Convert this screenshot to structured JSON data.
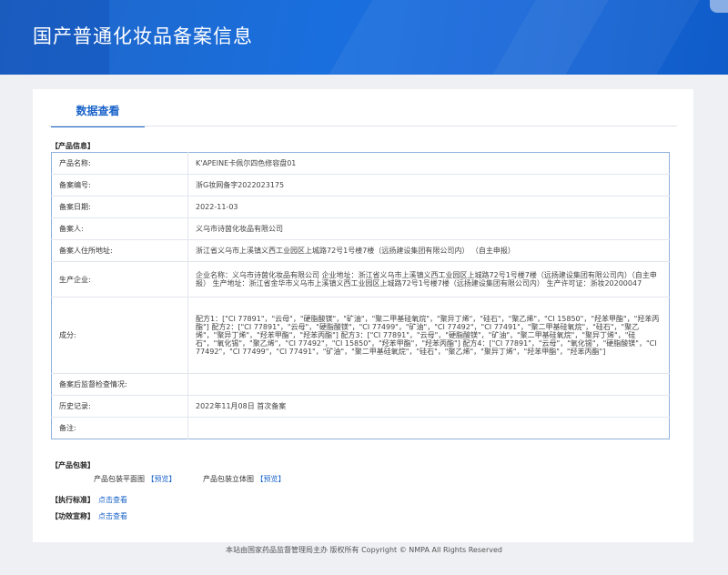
{
  "page_title": "国产普通化妆品备案信息",
  "tab_label": "数据查看",
  "product_info": {
    "section_title": "【产品信息】",
    "rows": [
      {
        "key": "产品名称:",
        "value": "K'APEINE卡佩尔四色修容盘01"
      },
      {
        "key": "备案编号:",
        "value": "浙G妆网备字2022023175"
      },
      {
        "key": "备案日期:",
        "value": "2022-11-03"
      },
      {
        "key": "备案人:",
        "value": "义乌市诗茵化妆品有限公司"
      },
      {
        "key": "备案人住所地址:",
        "value": "浙江省义乌市上溪镇义西工业园区上城路72号1号楼7楼（远扬建设集团有限公司内） （自主申报）"
      },
      {
        "key": "生产企业:",
        "value": "企业名称：义乌市诗茵化妆品有限公司 企业地址：浙江省义乌市上溪镇义西工业园区上城路72号1号楼7楼（远扬建设集团有限公司内）（自主申报） 生产地址：浙江省金华市义乌市上溪镇义西工业园区上城路72号1号楼7楼（远扬建设集团有限公司内） 生产许可证：浙妆20200047"
      },
      {
        "key": "成分:",
        "value": "配方1：[\"CI 77891\"，\"云母\"，\"硬脂酸镁\"，\"矿油\"，\"聚二甲基硅氧烷\"，\"聚异丁烯\"，\"硅石\"，\"聚乙烯\"，\"CI 15850\"，\"羟苯甲酯\"，\"羟苯丙酯\"] 配方2：[\"CI 77891\"，\"云母\"，\"硬脂酸镁\"，\"CI 77499\"，\"矿油\"，\"CI 77492\"，\"CI 77491\"，\"聚二甲基硅氧烷\"，\"硅石\"，\"聚乙烯\"，\"聚异丁烯\"，\"羟苯甲酯\"，\"羟苯丙酯\"] 配方3：[\"CI 77891\"，\"云母\"，\"硬脂酸镁\"，\"矿油\"，\"聚二甲基硅氧烷\"，\"聚异丁烯\"，\"硅石\"，\"氧化锡\"，\"聚乙烯\"，\"CI 77492\"，\"CI 15850\"，\"羟苯甲酯\"，\"羟苯丙酯\"] 配方4：[\"CI 77891\"，\"云母\"，\"氧化锡\"，\"硬脂酸镁\"，\"CI 77492\"，\"CI 77499\"，\"CI 77491\"，\"矿油\"，\"聚二甲基硅氧烷\"，\"硅石\"，\"聚乙烯\"，\"聚异丁烯\"，\"羟苯甲酯\"，\"羟苯丙酯\"]"
      },
      {
        "key": "备案后监督检查情况:",
        "value": ""
      },
      {
        "key": "历史记录:",
        "value": "2022年11月08日 首次备案"
      },
      {
        "key": "备注:",
        "value": ""
      }
    ]
  },
  "packaging": {
    "section_title": "【产品包装】",
    "flat_label": "产品包装平面图",
    "solid_label": "产品包装立体图",
    "preview_link": "【预览】"
  },
  "standard": {
    "section_title": "【执行标准】",
    "link": "点击查看"
  },
  "efficacy": {
    "section_title": "【功效宣称】",
    "link": "点击查看"
  },
  "footer": "本站由国家药品监督管理局主办 版权所有 Copyright © NMPA All Rights Reserved"
}
